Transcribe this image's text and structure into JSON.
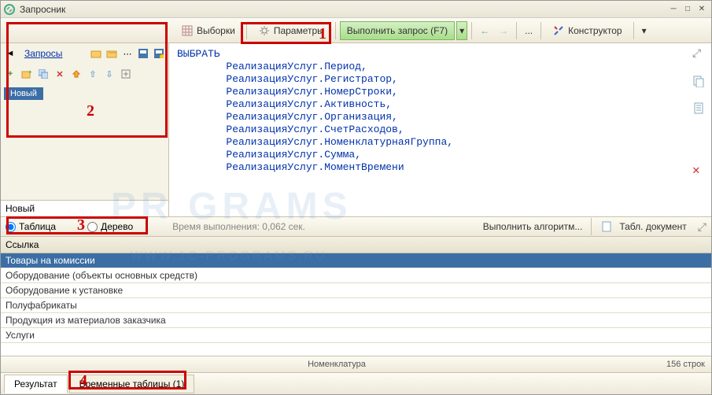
{
  "title": "Запросник",
  "toolbar": {
    "queries_link": "Запросы",
    "selections": "Выборки",
    "parameters": "Параметры",
    "execute": "Выполнить запрос (F7)",
    "constructor": "Конструктор",
    "dots": "..."
  },
  "leftpanel": {
    "tab_new": "Новый",
    "footer": "Новый"
  },
  "code": "ВЫБРАТЬ\n        РеализацияУслуг.Период,\n        РеализацияУслуг.Регистратор,\n        РеализацияУслуг.НомерСтроки,\n        РеализацияУслуг.Активность,\n        РеализацияУслуг.Организация,\n        РеализацияУслуг.СчетРасходов,\n        РеализацияУслуг.НоменклатурнаяГруппа,\n        РеализацияУслуг.Сумма,\n        РеализацияУслуг.МоментВремени",
  "midbar": {
    "radio_table": "Таблица",
    "radio_tree": "Дерево",
    "exec_time": "Время выполнения: 0,062 сек.",
    "run_algo": "Выполнить алгоритм...",
    "tabl_doc": "Табл. документ"
  },
  "grid": {
    "header": "Ссылка",
    "rows": [
      "Товары на комиссии",
      "Оборудование (объекты основных средств)",
      "Оборудование к установке",
      "Полуфабрикаты",
      "Продукция из материалов заказчика",
      "Услуги"
    ]
  },
  "status": {
    "center": "Номенклатура",
    "right": "156 строк"
  },
  "bottomtabs": {
    "result": "Результат",
    "temp_tables": "Временные таблицы (1)"
  },
  "redlabels": {
    "l1": "1",
    "l2": "2",
    "l3": "3",
    "l4": "4"
  },
  "watermark": "PR   GRAMS",
  "watermark2": "WWW.1C-PROGRAMS.RU"
}
